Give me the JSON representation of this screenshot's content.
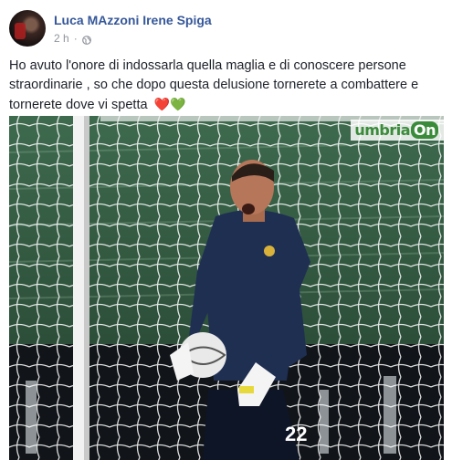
{
  "post": {
    "author": "Luca MAzzoni Irene Spiga",
    "timestamp": "2 h",
    "separator": "·",
    "privacy_icon": "globe-icon",
    "text": "Ho avuto l'onore di indossarla quella maglia e di conoscere persone straordinarie , so che dopo questa delusione tornerete a combattere e tornerete dove vi spetta",
    "emojis": "❤️💚",
    "photo": {
      "watermark": "umbria",
      "watermark_suffix": "On",
      "jersey_number": "22"
    }
  },
  "colors": {
    "link_blue": "#365899",
    "meta_gray": "#90949c",
    "pitch_green": "#2f5a3e",
    "goalkeeper_kit": "#1f2f52"
  }
}
